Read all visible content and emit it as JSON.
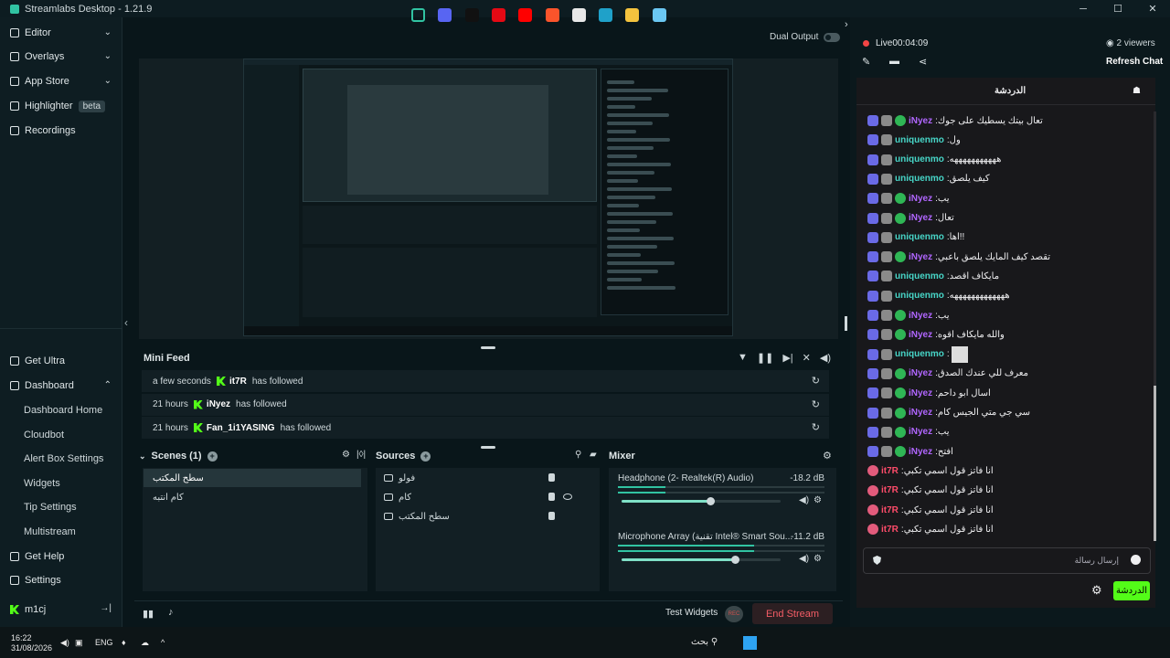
{
  "app": {
    "title": "Streamlabs Desktop - 1.21.9"
  },
  "sidebar": {
    "top": [
      {
        "label": "Editor",
        "chevron": "⌄"
      },
      {
        "label": "Overlays",
        "chevron": "⌄"
      },
      {
        "label": "App Store",
        "chevron": "⌄"
      },
      {
        "label": "Highlighter",
        "badge": "beta"
      },
      {
        "label": "Recordings"
      }
    ],
    "get_ultra": "Get Ultra",
    "dashboard": "Dashboard",
    "dashboard_items": [
      "Dashboard Home",
      "Cloudbot",
      "Alert Box Settings",
      "Widgets",
      "Tip Settings",
      "Multistream"
    ],
    "get_help": "Get Help",
    "settings": "Settings",
    "user": "m1cj"
  },
  "main": {
    "dual_output": "Dual Output"
  },
  "mini_feed": {
    "title": "Mini Feed",
    "events": [
      {
        "time": "a few seconds",
        "user": "it7R",
        "action": "has followed"
      },
      {
        "time": "21 hours",
        "user": "iNyez",
        "action": "has followed"
      },
      {
        "time": "21 hours",
        "user": "Fan_1i1YASING",
        "action": "has followed"
      }
    ]
  },
  "scenes": {
    "title": "Scenes (1)",
    "items": [
      "سطح المكتب",
      "كام انتبه"
    ]
  },
  "sources": {
    "title": "Sources",
    "items": [
      "فولو",
      "كام",
      "سطح المكتب"
    ]
  },
  "mixer": {
    "title": "Mixer",
    "channels": [
      {
        "name": "Headphone (2- Realtek(R) Audio)",
        "db": "-18.2 dB",
        "level": 0.23,
        "volume": 0.56
      },
      {
        "name": "Microphone Array (تقنية Intel® Smart Sou...",
        "db": "-11.2 dB",
        "level": 0.66,
        "volume": 0.71
      }
    ]
  },
  "footer": {
    "test_widgets": "Test Widgets",
    "rec": "REC",
    "end_stream": "End Stream"
  },
  "stream": {
    "live": "Live",
    "time": "00:04:09",
    "viewers": "2 viewers",
    "refresh": "Refresh Chat"
  },
  "chat": {
    "header": "الدردشة",
    "messages": [
      {
        "user": "iNyez",
        "color": "#b166ff",
        "badges": [
          "b1",
          "b2",
          "b3"
        ],
        "text": "تعال بيتك يسطيك على جوك"
      },
      {
        "user": "uniquenmo",
        "color": "#47d6c8",
        "badges": [
          "b1",
          "b2"
        ],
        "text": "ول"
      },
      {
        "user": "uniquenmo",
        "color": "#47d6c8",
        "badges": [
          "b1",
          "b2"
        ],
        "text": "هههههههههههه"
      },
      {
        "user": "uniquenmo",
        "color": "#47d6c8",
        "badges": [
          "b1",
          "b2"
        ],
        "text": "كيف يلصق"
      },
      {
        "user": "iNyez",
        "color": "#b166ff",
        "badges": [
          "b1",
          "b2",
          "b3"
        ],
        "text": "يب"
      },
      {
        "user": "iNyez",
        "color": "#b166ff",
        "badges": [
          "b1",
          "b2",
          "b3"
        ],
        "text": "تعال"
      },
      {
        "user": "uniquenmo",
        "color": "#47d6c8",
        "badges": [
          "b1",
          "b2"
        ],
        "text": "اها!!"
      },
      {
        "user": "iNyez",
        "color": "#b166ff",
        "badges": [
          "b1",
          "b2",
          "b3"
        ],
        "text": "تقصد كيف المايك يلصق باعبي"
      },
      {
        "user": "uniquenmo",
        "color": "#47d6c8",
        "badges": [
          "b1",
          "b2"
        ],
        "text": "مايكاف اقصد"
      },
      {
        "user": "uniquenmo",
        "color": "#47d6c8",
        "badges": [
          "b1",
          "b2"
        ],
        "text": "هههههههههههههه"
      },
      {
        "user": "iNyez",
        "color": "#b166ff",
        "badges": [
          "b1",
          "b2",
          "b3"
        ],
        "text": "يب"
      },
      {
        "user": "iNyez",
        "color": "#b166ff",
        "badges": [
          "b1",
          "b2",
          "b3"
        ],
        "text": "والله مايكاف اقوه"
      },
      {
        "user": "uniquenmo",
        "color": "#47d6c8",
        "badges": [
          "b1",
          "b2"
        ],
        "text": "",
        "emote": true
      },
      {
        "user": "iNyez",
        "color": "#b166ff",
        "badges": [
          "b1",
          "b2",
          "b3"
        ],
        "text": "معرف للي عندك الصدق"
      },
      {
        "user": "iNyez",
        "color": "#b166ff",
        "badges": [
          "b1",
          "b2",
          "b3"
        ],
        "text": "اسال ابو داحم"
      },
      {
        "user": "iNyez",
        "color": "#b166ff",
        "badges": [
          "b1",
          "b2",
          "b3"
        ],
        "text": "سي جي متي الجيس كام"
      },
      {
        "user": "iNyez",
        "color": "#b166ff",
        "badges": [
          "b1",
          "b2",
          "b3"
        ],
        "text": "يب"
      },
      {
        "user": "iNyez",
        "color": "#b166ff",
        "badges": [
          "b1",
          "b2",
          "b3"
        ],
        "text": "افتح"
      },
      {
        "user": "it7R",
        "color": "#ff4c6a",
        "badges": [
          "b4"
        ],
        "text": "انا فاتز قول اسمي تكبي"
      },
      {
        "user": "it7R",
        "color": "#ff4c6a",
        "badges": [
          "b4"
        ],
        "text": "انا فاتز قول اسمي تكبي"
      },
      {
        "user": "it7R",
        "color": "#ff4c6a",
        "badges": [
          "b4"
        ],
        "text": "انا فاتز قول اسمي تكبي"
      },
      {
        "user": "it7R",
        "color": "#ff4c6a",
        "badges": [
          "b4"
        ],
        "text": "انا فاتز قول اسمي تكبي"
      }
    ],
    "input_placeholder": "إرسال رسالة",
    "send": "الدردشة"
  },
  "taskbar": {
    "time": "16:22",
    "date": "31/08/2026",
    "lang": "ENG",
    "search": "بحث"
  }
}
